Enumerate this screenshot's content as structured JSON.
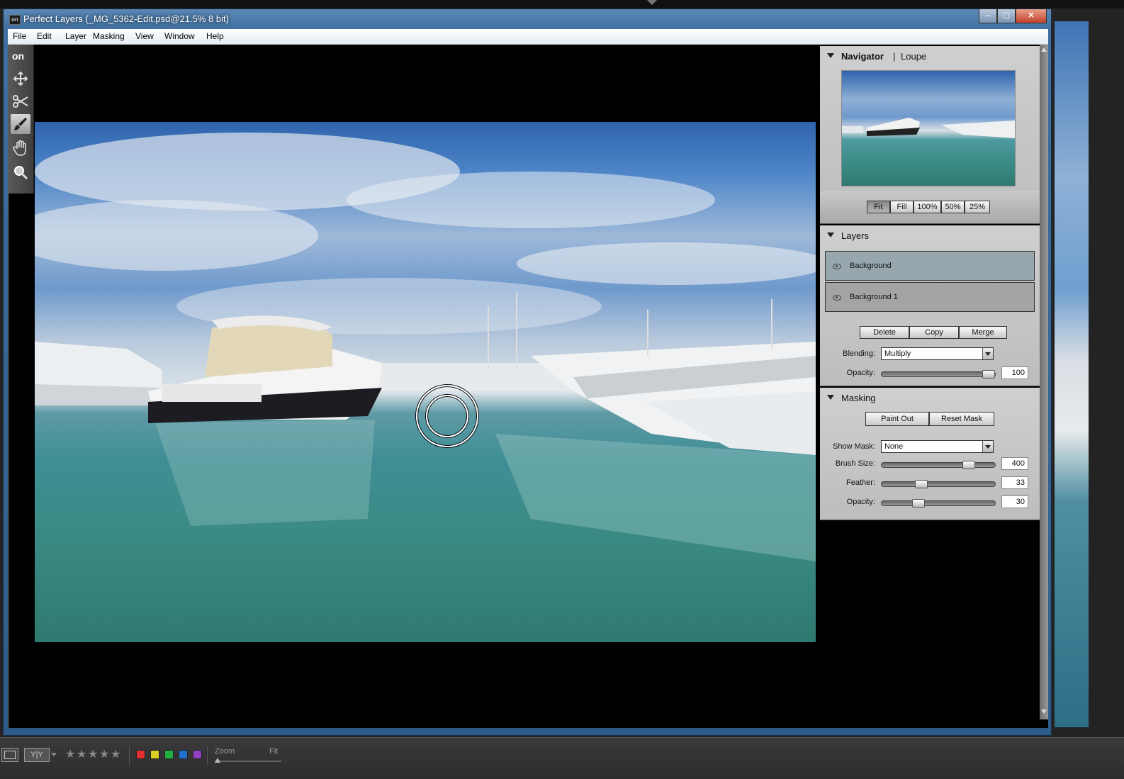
{
  "window": {
    "title": "Perfect Layers (_MG_5362-Edit.psd@21.5% 8 bit)",
    "app_icon_text": "on",
    "min_label": "‒",
    "max_label": "▢",
    "close_label": "✕"
  },
  "menu": [
    "File",
    "Edit",
    "Layer",
    "Masking",
    "View",
    "Window",
    "Help"
  ],
  "tools": [
    "on1-logo-icon",
    "move-icon",
    "scissors-icon",
    "brush-icon",
    "hand-icon",
    "zoom-icon"
  ],
  "navigator": {
    "title": "Navigator",
    "separator": "|",
    "loupe": "Loupe",
    "zoom_buttons": [
      "Fit",
      "Fill",
      "100%",
      "50%",
      "25%"
    ],
    "selected_zoom": "Fit"
  },
  "layers": {
    "title": "Layers",
    "items": [
      {
        "name": "Background",
        "selected": true
      },
      {
        "name": "Background 1",
        "selected": false
      }
    ],
    "delete_label": "Delete",
    "copy_label": "Copy",
    "merge_label": "Merge",
    "blending_label": "Blending:",
    "blending_value": "Multiply",
    "opacity_label": "Opacity:",
    "opacity_value": "100",
    "opacity_fraction": 1.0
  },
  "masking": {
    "title": "Masking",
    "paint_out_label": "Paint Out",
    "reset_mask_label": "Reset Mask",
    "show_mask_label": "Show Mask:",
    "show_mask_value": "None",
    "brush_size_label": "Brush Size:",
    "brush_size_value": "400",
    "brush_size_fraction": 0.8,
    "feather_label": "Feather:",
    "feather_value": "33",
    "feather_fraction": 0.33,
    "opacity_label": "Opacity:",
    "opacity_value": "30",
    "opacity_fraction": 0.3
  },
  "bottom": {
    "zoom_label": "Zoom",
    "fit_label": "Fit",
    "star_glyph": "★",
    "star_count": 5,
    "color_labels": [
      "#e03030",
      "#d8d020",
      "#20b040",
      "#2070d0",
      "#9040c0"
    ]
  }
}
